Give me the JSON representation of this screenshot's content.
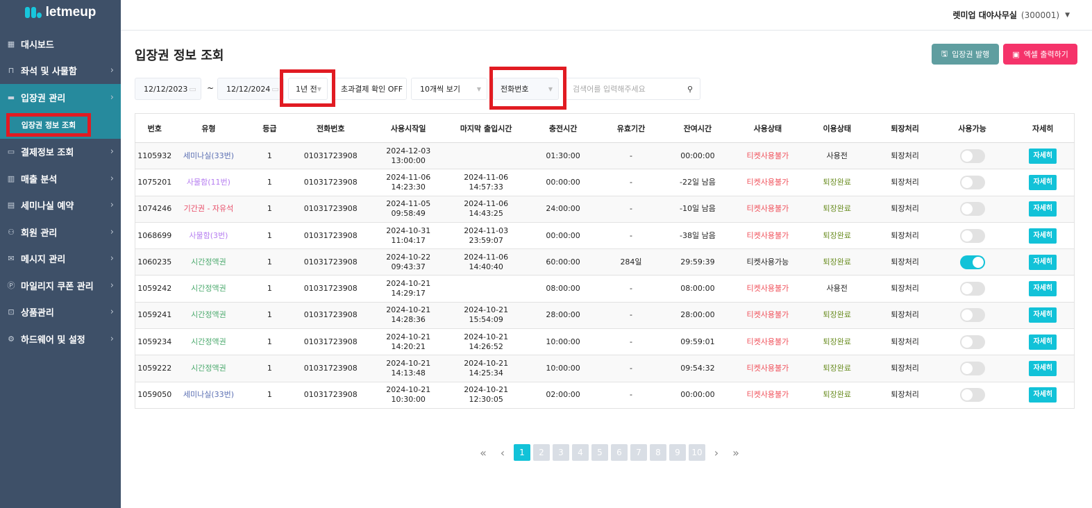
{
  "brand": "letmeup",
  "sidebar": {
    "items": [
      {
        "icon": "grid-icon",
        "glyph": "▦",
        "label": "대시보드",
        "chev": false
      },
      {
        "icon": "seat-icon",
        "glyph": "⊓",
        "label": "좌석 및 사물함",
        "chev": true
      },
      {
        "icon": "ticket-icon",
        "glyph": "▬",
        "label": "입장권 관리",
        "chev": true,
        "active": true
      },
      {
        "icon": "card-icon",
        "glyph": "▭",
        "label": "결제정보 조회",
        "chev": true
      },
      {
        "icon": "chart-icon",
        "glyph": "▥",
        "label": "매출 분석",
        "chev": true
      },
      {
        "icon": "calendar-icon",
        "glyph": "▤",
        "label": "세미나실 예약",
        "chev": true
      },
      {
        "icon": "users-icon",
        "glyph": "⚇",
        "label": "회원 관리",
        "chev": true
      },
      {
        "icon": "mail-icon",
        "glyph": "✉",
        "label": "메시지 관리",
        "chev": true
      },
      {
        "icon": "coupon-icon",
        "glyph": "Ⓟ",
        "label": "마일리지 쿠폰 관리",
        "chev": true
      },
      {
        "icon": "bag-icon",
        "glyph": "⊡",
        "label": "상품관리",
        "chev": true
      },
      {
        "icon": "gear-icon",
        "glyph": "⚙",
        "label": "하드웨어 및 설정",
        "chev": true
      }
    ],
    "sub_item": "입장권 정보 조회"
  },
  "header": {
    "account": "렛미업 대야사무실",
    "code": "(300001)"
  },
  "page": {
    "title": "입장권 정보 조회",
    "issue_label": "입장권 발행",
    "excel_label": "엑셀 출력하기"
  },
  "filters": {
    "start_date": "12/12/2023",
    "tilde": "~",
    "end_date": "12/12/2024",
    "period": "1년 전",
    "overpay": "초과결제 확인 OFF",
    "page_size": "10개씩 보기",
    "search_field": "전화번호",
    "search_placeholder": "검색어를 입력해주세요"
  },
  "colors": {
    "accent": "#12c2d8",
    "issue_btn": "#5f9ea0",
    "excel_btn": "#f5336a",
    "unusable": "#f0505a",
    "exited": "#6b8e23",
    "seminar": "#5b6fb3",
    "locker": "#b57cf0",
    "period": "#e8506a",
    "time": "#4caa6e"
  },
  "table": {
    "headers": [
      "번호",
      "유형",
      "등급",
      "전화번호",
      "사용시작일",
      "마지막 출입시간",
      "충전시간",
      "유효기간",
      "잔여시간",
      "사용상태",
      "이용상태",
      "퇴장처리",
      "사용가능",
      "자세히"
    ],
    "rows": [
      {
        "id": "1105932",
        "type": "세미나실(33번)",
        "tcolor": "seminar",
        "grade": "1",
        "phone": "01031723908",
        "start": [
          "2024-12-03",
          "13:00:00"
        ],
        "last": [
          "",
          ""
        ],
        "charge": "01:30:00",
        "valid": "-",
        "remain": "00:00:00",
        "status": "티켓사용불가",
        "use": "사용전",
        "exit": "퇴장처리",
        "on": false,
        "detail": "자세히"
      },
      {
        "id": "1075201",
        "type": "사물함(11번)",
        "tcolor": "locker",
        "grade": "1",
        "phone": "01031723908",
        "start": [
          "2024-11-06",
          "14:23:30"
        ],
        "last": [
          "2024-11-06",
          "14:57:33"
        ],
        "charge": "00:00:00",
        "valid": "-",
        "remain": "-22일 남음",
        "status": "티켓사용불가",
        "use": "퇴장완료",
        "exit": "퇴장처리",
        "on": false,
        "detail": "자세히"
      },
      {
        "id": "1074246",
        "type": "기간권 - 자유석",
        "tcolor": "period",
        "grade": "1",
        "phone": "01031723908",
        "start": [
          "2024-11-05",
          "09:58:49"
        ],
        "last": [
          "2024-11-06",
          "14:43:25"
        ],
        "charge": "24:00:00",
        "valid": "-",
        "remain": "-10일 남음",
        "status": "티켓사용불가",
        "use": "퇴장완료",
        "exit": "퇴장처리",
        "on": false,
        "detail": "자세히"
      },
      {
        "id": "1068699",
        "type": "사물함(3번)",
        "tcolor": "locker",
        "grade": "1",
        "phone": "01031723908",
        "start": [
          "2024-10-31",
          "11:04:17"
        ],
        "last": [
          "2024-11-03",
          "23:59:07"
        ],
        "charge": "00:00:00",
        "valid": "-",
        "remain": "-38일 남음",
        "status": "티켓사용불가",
        "use": "퇴장완료",
        "exit": "퇴장처리",
        "on": false,
        "detail": "자세히"
      },
      {
        "id": "1060235",
        "type": "시간정액권",
        "tcolor": "time",
        "grade": "1",
        "phone": "01031723908",
        "start": [
          "2024-10-22",
          "09:43:37"
        ],
        "last": [
          "2024-11-06",
          "14:40:40"
        ],
        "charge": "60:00:00",
        "valid": "284일",
        "remain": "29:59:39",
        "status": "티켓사용가능",
        "use": "퇴장완료",
        "exit": "퇴장처리",
        "on": true,
        "detail": "자세히"
      },
      {
        "id": "1059242",
        "type": "시간정액권",
        "tcolor": "time",
        "grade": "1",
        "phone": "01031723908",
        "start": [
          "2024-10-21",
          "14:29:17"
        ],
        "last": [
          "",
          ""
        ],
        "charge": "08:00:00",
        "valid": "-",
        "remain": "08:00:00",
        "status": "티켓사용불가",
        "use": "사용전",
        "exit": "퇴장처리",
        "on": false,
        "detail": "자세히"
      },
      {
        "id": "1059241",
        "type": "시간정액권",
        "tcolor": "time",
        "grade": "1",
        "phone": "01031723908",
        "start": [
          "2024-10-21",
          "14:28:36"
        ],
        "last": [
          "2024-10-21",
          "15:54:09"
        ],
        "charge": "28:00:00",
        "valid": "-",
        "remain": "28:00:00",
        "status": "티켓사용불가",
        "use": "퇴장완료",
        "exit": "퇴장처리",
        "on": false,
        "detail": "자세히"
      },
      {
        "id": "1059234",
        "type": "시간정액권",
        "tcolor": "time",
        "grade": "1",
        "phone": "01031723908",
        "start": [
          "2024-10-21",
          "14:20:21"
        ],
        "last": [
          "2024-10-21",
          "14:26:52"
        ],
        "charge": "10:00:00",
        "valid": "-",
        "remain": "09:59:01",
        "status": "티켓사용불가",
        "use": "퇴장완료",
        "exit": "퇴장처리",
        "on": false,
        "detail": "자세히"
      },
      {
        "id": "1059222",
        "type": "시간정액권",
        "tcolor": "time",
        "grade": "1",
        "phone": "01031723908",
        "start": [
          "2024-10-21",
          "14:13:48"
        ],
        "last": [
          "2024-10-21",
          "14:25:34"
        ],
        "charge": "10:00:00",
        "valid": "-",
        "remain": "09:54:32",
        "status": "티켓사용불가",
        "use": "퇴장완료",
        "exit": "퇴장처리",
        "on": false,
        "detail": "자세히"
      },
      {
        "id": "1059050",
        "type": "세미나실(33번)",
        "tcolor": "seminar",
        "grade": "1",
        "phone": "01031723908",
        "start": [
          "2024-10-21",
          "10:30:00"
        ],
        "last": [
          "2024-10-21",
          "12:30:05"
        ],
        "charge": "02:00:00",
        "valid": "-",
        "remain": "00:00:00",
        "status": "티켓사용불가",
        "use": "퇴장완료",
        "exit": "퇴장처리",
        "on": false,
        "detail": "자세히"
      }
    ]
  },
  "pagination": {
    "current": 1,
    "pages": [
      "1",
      "2",
      "3",
      "4",
      "5",
      "6",
      "7",
      "8",
      "9",
      "10"
    ],
    "first": "«",
    "prev": "‹",
    "next": "›",
    "last": "»"
  }
}
